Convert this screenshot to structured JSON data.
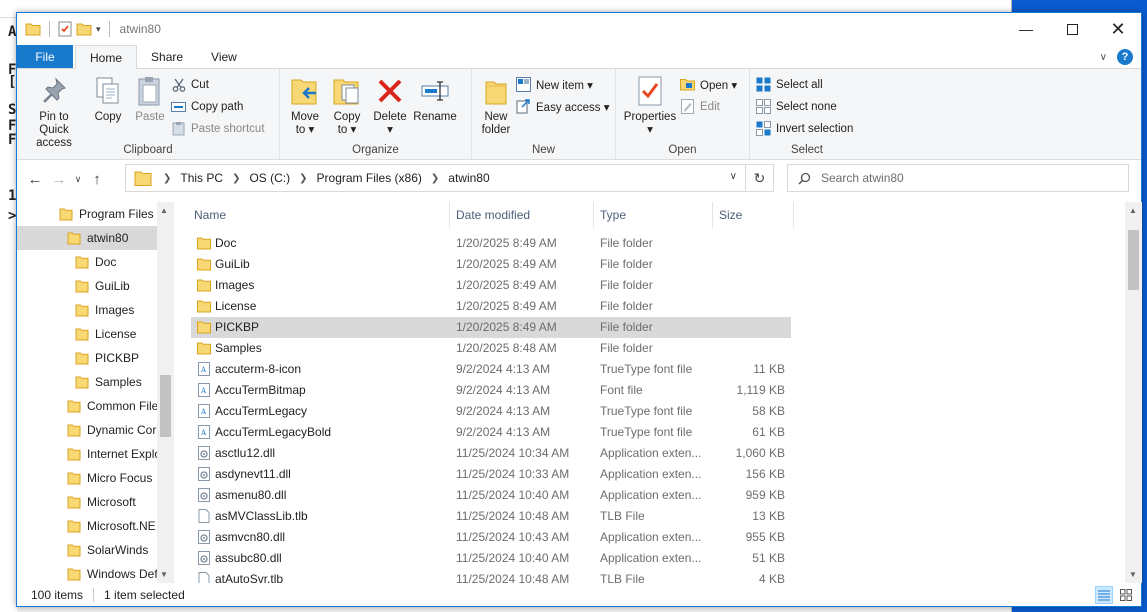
{
  "window": {
    "title": "atwin80"
  },
  "tabs": [
    {
      "label": "File"
    },
    {
      "label": "Home"
    },
    {
      "label": "Share"
    },
    {
      "label": "View"
    }
  ],
  "ribbon": {
    "clipboard": {
      "label": "Clipboard",
      "pin_line1": "Pin to Quick",
      "pin_line2": "access",
      "copy": "Copy",
      "paste": "Paste",
      "cut": "Cut",
      "copy_path": "Copy path",
      "paste_shortcut": "Paste shortcut"
    },
    "organize": {
      "label": "Organize",
      "move_line1": "Move",
      "move_line2": "to ▾",
      "copy_line1": "Copy",
      "copy_line2": "to ▾",
      "delete_line1": "Delete",
      "delete_line2": "▾",
      "rename": "Rename"
    },
    "new": {
      "label": "New",
      "folder_line1": "New",
      "folder_line2": "folder",
      "new_item": "New item ▾",
      "easy_access": "Easy access ▾"
    },
    "open": {
      "label": "Open",
      "properties_line1": "Properties",
      "properties_line2": "▾",
      "open": "Open ▾",
      "edit": "Edit"
    },
    "select": {
      "label": "Select",
      "select_all": "Select all",
      "select_none": "Select none",
      "invert": "Invert selection"
    }
  },
  "address": {
    "crumbs": [
      "This PC",
      "OS (C:)",
      "Program Files (x86)",
      "atwin80"
    ]
  },
  "search": {
    "placeholder": "Search atwin80"
  },
  "nav": {
    "items": [
      {
        "label": "Program Files (",
        "indent": 0,
        "selected": false
      },
      {
        "label": "atwin80",
        "indent": 1,
        "selected": true
      },
      {
        "label": "Doc",
        "indent": 2,
        "selected": false
      },
      {
        "label": "GuiLib",
        "indent": 2,
        "selected": false
      },
      {
        "label": "Images",
        "indent": 2,
        "selected": false
      },
      {
        "label": "License",
        "indent": 2,
        "selected": false
      },
      {
        "label": "PICKBP",
        "indent": 2,
        "selected": false
      },
      {
        "label": "Samples",
        "indent": 2,
        "selected": false
      },
      {
        "label": "Common File",
        "indent": 1,
        "selected": false
      },
      {
        "label": "Dynamic Cor",
        "indent": 1,
        "selected": false
      },
      {
        "label": "Internet Explo",
        "indent": 1,
        "selected": false
      },
      {
        "label": "Micro Focus",
        "indent": 1,
        "selected": false
      },
      {
        "label": "Microsoft",
        "indent": 1,
        "selected": false
      },
      {
        "label": "Microsoft.NE",
        "indent": 1,
        "selected": false
      },
      {
        "label": "SolarWinds",
        "indent": 1,
        "selected": false
      },
      {
        "label": "Windows Def",
        "indent": 1,
        "selected": false
      }
    ]
  },
  "columns": {
    "name": "Name",
    "date": "Date modified",
    "type": "Type",
    "size": "Size"
  },
  "files": [
    {
      "name": "Doc",
      "date": "1/20/2025 8:49 AM",
      "type": "File folder",
      "size": "",
      "icon": "folder",
      "selected": false
    },
    {
      "name": "GuiLib",
      "date": "1/20/2025 8:49 AM",
      "type": "File folder",
      "size": "",
      "icon": "folder",
      "selected": false
    },
    {
      "name": "Images",
      "date": "1/20/2025 8:49 AM",
      "type": "File folder",
      "size": "",
      "icon": "folder",
      "selected": false
    },
    {
      "name": "License",
      "date": "1/20/2025 8:49 AM",
      "type": "File folder",
      "size": "",
      "icon": "folder",
      "selected": false
    },
    {
      "name": "PICKBP",
      "date": "1/20/2025 8:49 AM",
      "type": "File folder",
      "size": "",
      "icon": "folder",
      "selected": true
    },
    {
      "name": "Samples",
      "date": "1/20/2025 8:48 AM",
      "type": "File folder",
      "size": "",
      "icon": "folder",
      "selected": false
    },
    {
      "name": "accuterm-8-icon",
      "date": "9/2/2024 4:13 AM",
      "type": "TrueType font file",
      "size": "11 KB",
      "icon": "font",
      "selected": false
    },
    {
      "name": "AccuTermBitmap",
      "date": "9/2/2024 4:13 AM",
      "type": "Font file",
      "size": "1,119 KB",
      "icon": "font",
      "selected": false
    },
    {
      "name": "AccuTermLegacy",
      "date": "9/2/2024 4:13 AM",
      "type": "TrueType font file",
      "size": "58 KB",
      "icon": "font",
      "selected": false
    },
    {
      "name": "AccuTermLegacyBold",
      "date": "9/2/2024 4:13 AM",
      "type": "TrueType font file",
      "size": "61 KB",
      "icon": "font",
      "selected": false
    },
    {
      "name": "asctlu12.dll",
      "date": "11/25/2024 10:34 AM",
      "type": "Application exten...",
      "size": "1,060 KB",
      "icon": "dll",
      "selected": false
    },
    {
      "name": "asdynevt11.dll",
      "date": "11/25/2024 10:33 AM",
      "type": "Application exten...",
      "size": "156 KB",
      "icon": "dll",
      "selected": false
    },
    {
      "name": "asmenu80.dll",
      "date": "11/25/2024 10:40 AM",
      "type": "Application exten...",
      "size": "959 KB",
      "icon": "dll",
      "selected": false
    },
    {
      "name": "asMVClassLib.tlb",
      "date": "11/25/2024 10:48 AM",
      "type": "TLB File",
      "size": "13 KB",
      "icon": "file",
      "selected": false
    },
    {
      "name": "asmvcn80.dll",
      "date": "11/25/2024 10:43 AM",
      "type": "Application exten...",
      "size": "955 KB",
      "icon": "dll",
      "selected": false
    },
    {
      "name": "assubc80.dll",
      "date": "11/25/2024 10:40 AM",
      "type": "Application exten...",
      "size": "51 KB",
      "icon": "dll",
      "selected": false
    },
    {
      "name": "atAutoSvr.tlb",
      "date": "11/25/2024 10:48 AM",
      "type": "TLB File",
      "size": "4 KB",
      "icon": "file",
      "selected": false
    }
  ],
  "status": {
    "count": "100 items",
    "selection": "1 item selected"
  },
  "bg_window": {
    "letters": [
      "A",
      "F",
      "[",
      "S",
      "F",
      "F",
      "1",
      ">"
    ]
  },
  "colors": {
    "accent": "#1979ca",
    "folder": "#f8d775",
    "selection": "#d9d9d9",
    "desktop": "#0a5bd0"
  }
}
